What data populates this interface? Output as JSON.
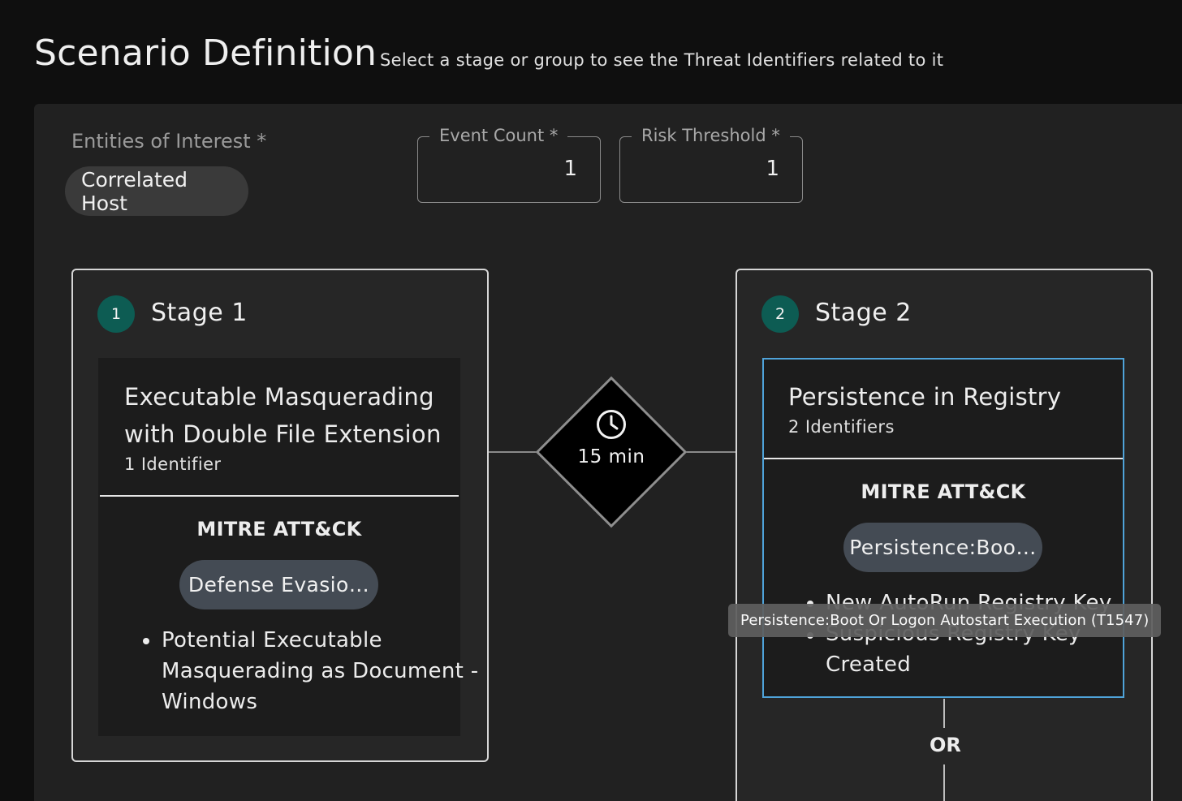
{
  "header": {
    "title": "Scenario Definition",
    "subtitle": "Select a stage or group to see the Threat Identifiers related to it"
  },
  "entities": {
    "label": "Entities of Interest *",
    "chips": [
      "Correlated Host"
    ]
  },
  "fields": {
    "event_count": {
      "label": "Event Count *",
      "value": "1"
    },
    "risk_threshold": {
      "label": "Risk Threshold *",
      "value": "1"
    }
  },
  "connector": {
    "time_window": "15 min",
    "icon": "clock-icon"
  },
  "stages": [
    {
      "number": "1",
      "title": "Stage 1",
      "groups": [
        {
          "title_lines": [
            "Executable Masquerading",
            "with Double File Extension"
          ],
          "count": "1 Identifier",
          "mitre_label": "MITRE ATT&CK",
          "tactic": "Defense Evasio…",
          "rules": [
            "Potential Executable",
            "Masquerading as Document -",
            "Windows"
          ]
        }
      ]
    },
    {
      "number": "2",
      "title": "Stage 2",
      "groups": [
        {
          "title_lines": [
            "Persistence in Registry"
          ],
          "count": "2 Identifiers",
          "mitre_label": "MITRE ATT&CK",
          "tactic": "Persistence:Boo…",
          "rules": [
            "New AutoRun Registry Key",
            "Suspicious Registry Key",
            "Created"
          ]
        }
      ],
      "operator": "OR"
    }
  ],
  "tooltip": "Persistence:Boot Or Logon Autostart Execution (T1547)",
  "colors": {
    "background": "#0f0f0f",
    "panel": "#212121",
    "badge": "#0d5c53",
    "selected_border": "#4fa3d9",
    "tactic_chip": "#444b54"
  }
}
